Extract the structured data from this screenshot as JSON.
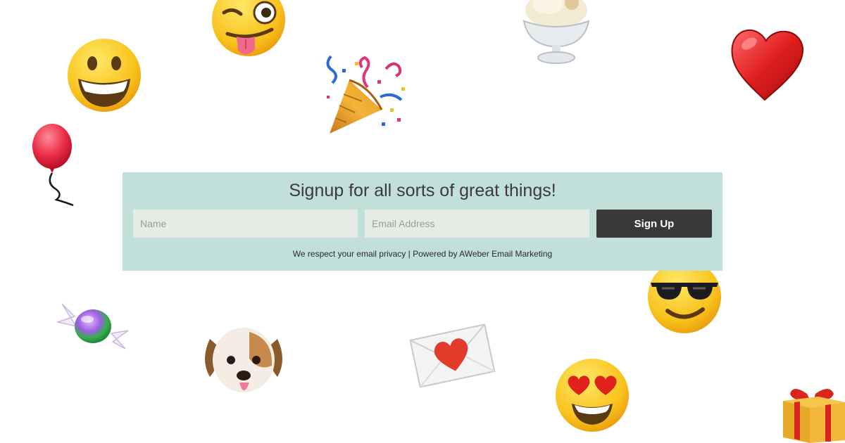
{
  "signup": {
    "title": "Signup for all sorts of great things!",
    "name_placeholder": "Name",
    "name_value": "",
    "email_placeholder": "Email Address",
    "email_value": "",
    "button_label": "Sign Up",
    "privacy_link": "We respect your email privacy",
    "separator": "|",
    "powered_by_link": "Powered by AWeber Email Marketing"
  },
  "colors": {
    "panel_bg": "#c1e0d9",
    "field_bg": "#e6ebe5",
    "button_bg": "#3b3937",
    "button_text": "#ffffff",
    "title_text": "#3b3b3b"
  },
  "decorations": [
    "grinning-face-icon",
    "winking-face-tongue-icon",
    "party-popper-icon",
    "ice-cream-icon",
    "red-heart-icon",
    "balloon-icon",
    "wrapped-candy-icon",
    "dog-face-icon",
    "love-letter-icon",
    "heart-eyes-face-icon",
    "sunglasses-face-icon",
    "gift-icon"
  ]
}
